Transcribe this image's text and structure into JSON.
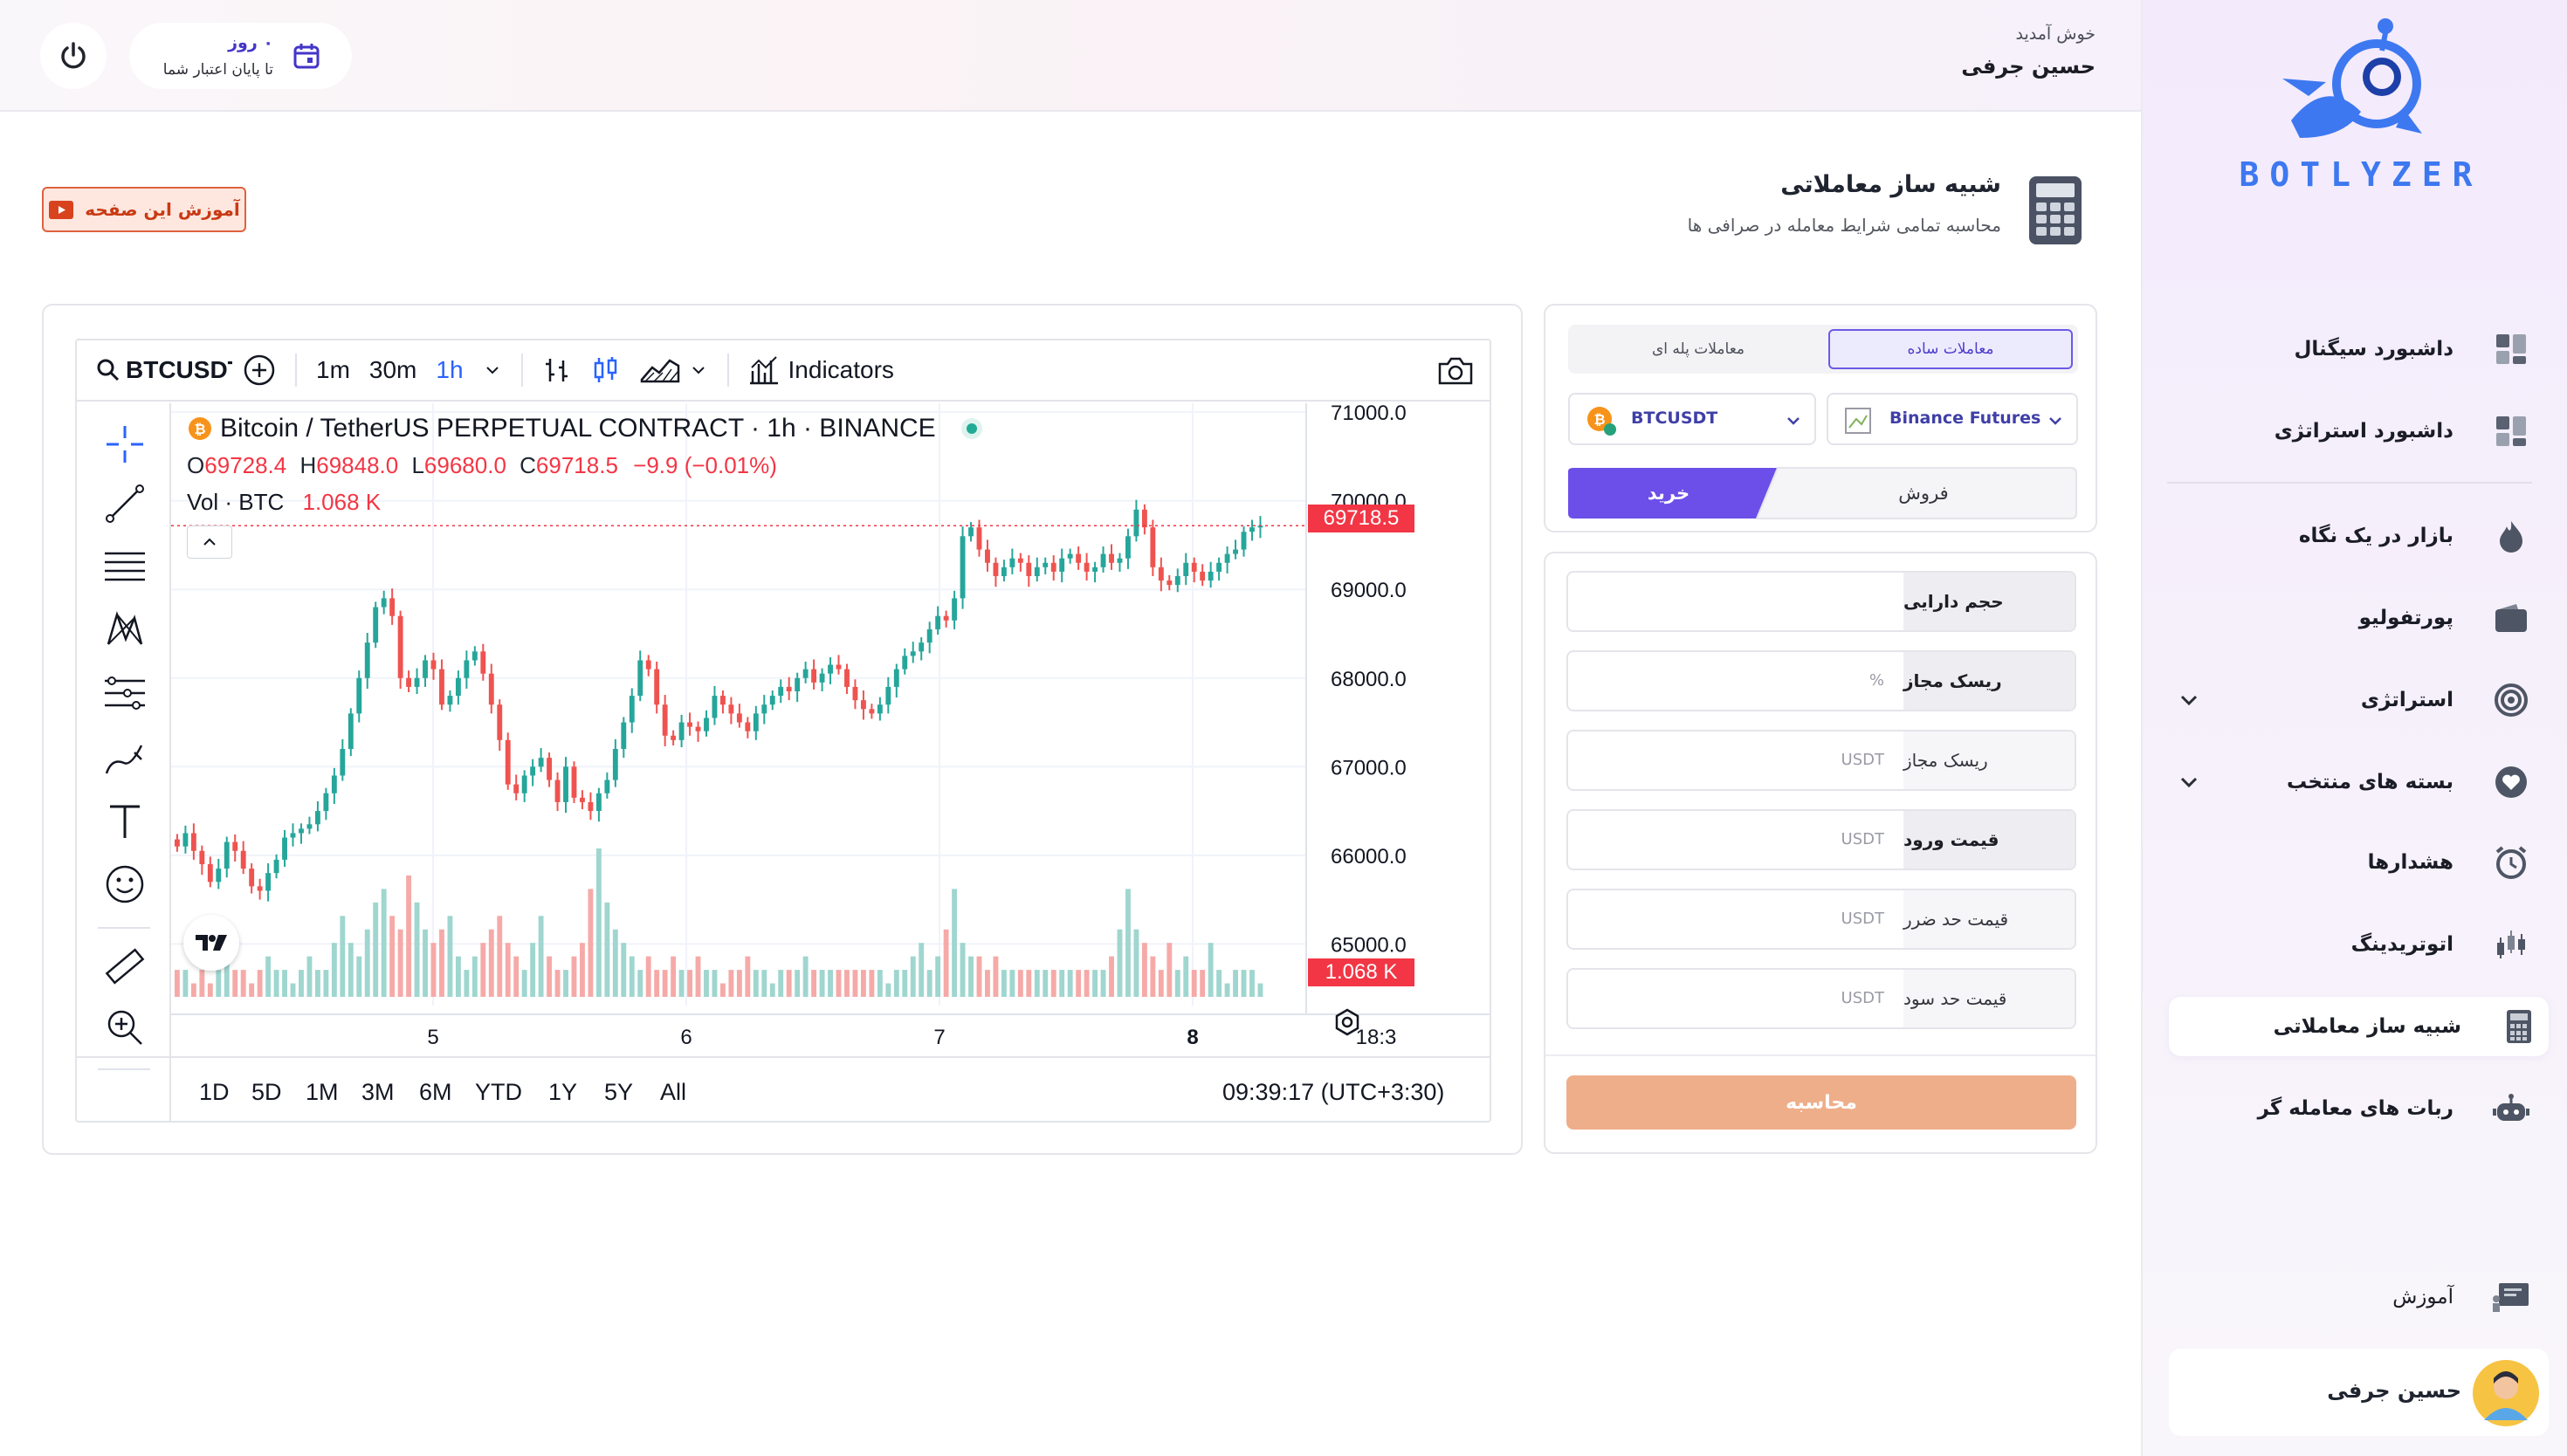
{
  "sidebar": {
    "logo_text": "BOTLYZER",
    "items": [
      {
        "label": "داشبورد سیگنال",
        "icon": "dashboard-icon"
      },
      {
        "label": "داشبورد استراتژی",
        "icon": "dashboard-icon"
      },
      {
        "label": "بازار در یک نگاه",
        "icon": "flame-icon"
      },
      {
        "label": "پورتفولیو",
        "icon": "wallet-icon"
      },
      {
        "label": "استراتژی",
        "icon": "target-icon"
      },
      {
        "label": "بسته های منتخب",
        "icon": "heart-icon"
      },
      {
        "label": "هشدارها",
        "icon": "alarm-clock-icon"
      },
      {
        "label": "اتوتریدینگ",
        "icon": "candles-icon"
      },
      {
        "label": "شبیه ساز معاملاتی",
        "icon": "calculator-icon"
      },
      {
        "label": "ربات های معامله گر",
        "icon": "robot-icon"
      }
    ],
    "education": "آموزش",
    "user_name": "حسین جرفی"
  },
  "header": {
    "welcome": "خوش آمدید",
    "user_name": "حسین جرفی",
    "credit_days": "۰ روز",
    "credit_text": "تا پایان اعتبار شما"
  },
  "page": {
    "title": "شبیه ساز معاملاتی",
    "subtitle": "محاسبه تمامی شرایط معامله در صرافی ها",
    "tutorial_button": "آموزش این صفحه"
  },
  "chart_toolbar": {
    "symbol": "BTCUSDT",
    "intervals": [
      "1m",
      "30m",
      "1h"
    ],
    "selected_interval": "1h",
    "indicators_label": "Indicators"
  },
  "chart_legend": {
    "title": "Bitcoin / TetherUS PERPETUAL CONTRACT · 1h · BINANCE",
    "o": "69728.4",
    "h": "69848.0",
    "l": "69680.0",
    "c": "69718.5",
    "change": "−9.9 (−0.01%)",
    "vol_label": "Vol · BTC",
    "vol_value": "1.068 K",
    "last_price_tag": "69718.5",
    "vol_tag": "1.068 K"
  },
  "chart_bottom": {
    "ranges": [
      "1D",
      "5D",
      "1M",
      "3M",
      "6M",
      "YTD",
      "1Y",
      "5Y",
      "All"
    ],
    "time": "09:39:17 (UTC+3:30)"
  },
  "chart_data": {
    "type": "candlestick",
    "symbol": "BTCUSDT",
    "interval": "1h",
    "y_ticks": [
      71000.0,
      70000.0,
      69000.0,
      68000.0,
      67000.0,
      66000.0,
      65000.0
    ],
    "ylim": [
      64600,
      71100
    ],
    "x_ticks": [
      "5",
      "6",
      "7",
      "8",
      "18:3"
    ],
    "last_price": 69718.5,
    "close_series": [
      66100,
      66250,
      66050,
      65900,
      65700,
      65850,
      66150,
      66050,
      65850,
      65650,
      65600,
      65800,
      65950,
      66200,
      66250,
      66300,
      66350,
      66500,
      66700,
      66900,
      67200,
      67600,
      68000,
      68400,
      68800,
      68900,
      68700,
      68000,
      67900,
      68000,
      68200,
      68100,
      67700,
      67800,
      68000,
      68200,
      68300,
      68050,
      67700,
      67300,
      66800,
      66700,
      66900,
      67000,
      67100,
      66850,
      66600,
      67000,
      66650,
      66600,
      66500,
      66700,
      66850,
      67200,
      67500,
      67800,
      68200,
      68100,
      67700,
      67350,
      67300,
      67500,
      67450,
      67400,
      67550,
      67800,
      67700,
      67600,
      67500,
      67400,
      67600,
      67700,
      67800,
      67900,
      67850,
      68000,
      68100,
      67950,
      68050,
      68150,
      68100,
      67900,
      67750,
      67650,
      67600,
      67700,
      67900,
      68100,
      68250,
      68300,
      68400,
      68550,
      68700,
      68650,
      68900,
      69600,
      69700,
      69450,
      69300,
      69150,
      69250,
      69350,
      69300,
      69150,
      69250,
      69300,
      69200,
      69350,
      69400,
      69300,
      69200,
      69250,
      69400,
      69300,
      69350,
      69600,
      69900,
      69700,
      69250,
      69100,
      69050,
      69150,
      69300,
      69200,
      69100,
      69200,
      69300,
      69400,
      69450,
      69650,
      69700,
      69718.5
    ],
    "volume_series": [
      2,
      2,
      1,
      2,
      1,
      2,
      3,
      2,
      2,
      1,
      2,
      3,
      2,
      2,
      1,
      2,
      3,
      2,
      2,
      4,
      6,
      4,
      3,
      5,
      7,
      8,
      6,
      5,
      9,
      7,
      5,
      4,
      5,
      6,
      3,
      2,
      3,
      4,
      5,
      6,
      4,
      3,
      2,
      4,
      6,
      3,
      2,
      2,
      3,
      4,
      8,
      11,
      7,
      5,
      4,
      3,
      2,
      3,
      2,
      2,
      3,
      2,
      2,
      3,
      2,
      2,
      1,
      2,
      2,
      3,
      2,
      2,
      1,
      2,
      2,
      2,
      3,
      2,
      2,
      2,
      2,
      2,
      2,
      2,
      2,
      2,
      1,
      2,
      2,
      3,
      4,
      2,
      3,
      5,
      8,
      4,
      3,
      3,
      2,
      3,
      2,
      2,
      2,
      2,
      2,
      2,
      2,
      2,
      2,
      2,
      2,
      2,
      2,
      3,
      5,
      8,
      5,
      4,
      3,
      2,
      4,
      2,
      3,
      2,
      2,
      4,
      2,
      1,
      2,
      2,
      2,
      1
    ],
    "up_color": "#26a69a",
    "down_color": "#ef5350"
  },
  "trade_panel": {
    "tab_simple": "معاملات ساده",
    "tab_ladder": "معاملات پله ای",
    "exchange": "Binance Futures",
    "pair": "BTCUSDT",
    "buy_label": "خرید",
    "sell_label": "فروش"
  },
  "form": {
    "rows": [
      {
        "label": "حجم دارایی",
        "unit": ""
      },
      {
        "label": "ریسک مجاز",
        "unit": "%"
      },
      {
        "label": "ریسک مجاز",
        "unit": "USDT"
      },
      {
        "label": "قیمت ورود",
        "unit": "USDT"
      },
      {
        "label": "قیمت حد ضرر",
        "unit": "USDT"
      },
      {
        "label": "قیمت حد سود",
        "unit": "USDT"
      }
    ],
    "submit": "محاسبه"
  },
  "colors": {
    "accent": "#6c4fe8",
    "calc_button": "#efae8a",
    "logo_blue": "#3d78f0",
    "tutorial_red": "#e0613e"
  }
}
